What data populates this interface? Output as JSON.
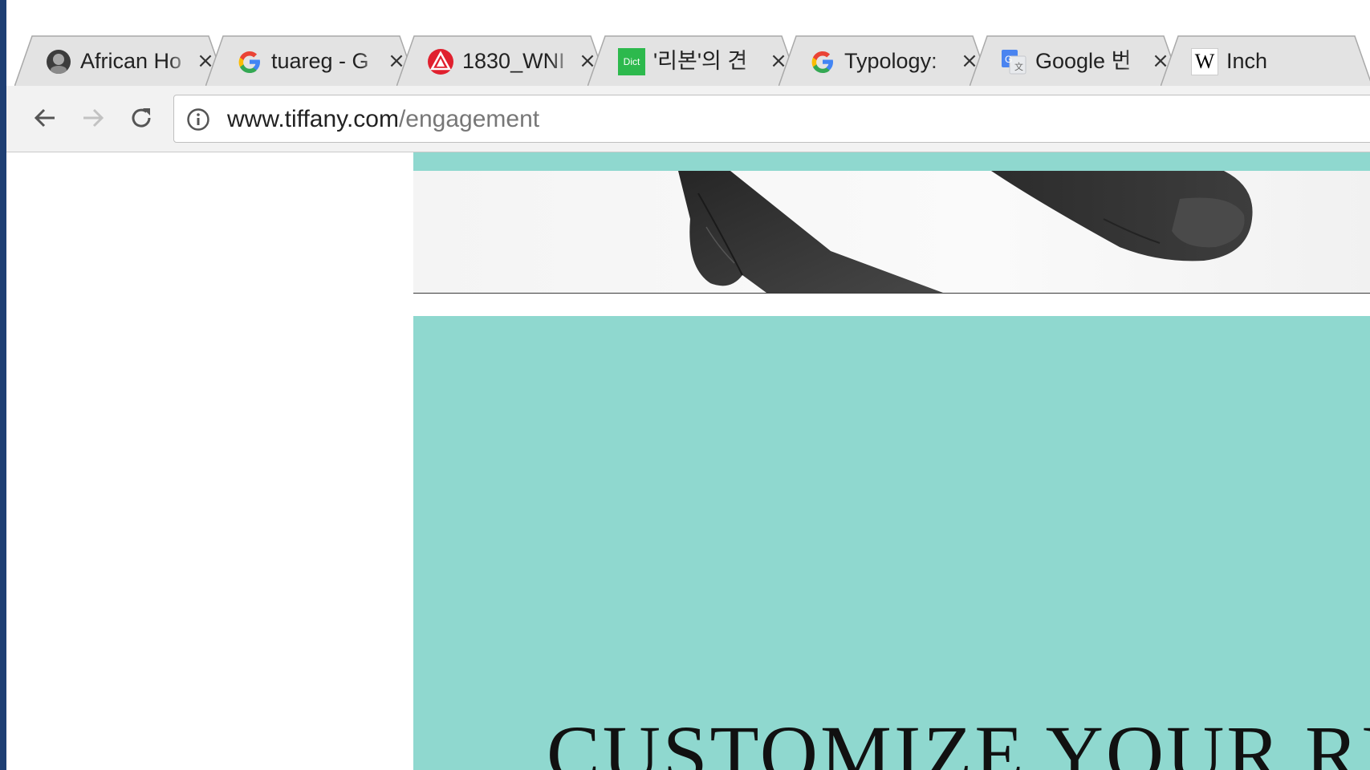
{
  "browser": {
    "tabs": [
      {
        "title": "African Ho",
        "favicon": "globe-face-icon"
      },
      {
        "title": "tuareg - G",
        "favicon": "google-icon"
      },
      {
        "title": "1830_WNI",
        "favicon": "red-triangle-icon"
      },
      {
        "title": "'리본'의 견",
        "favicon": "dict-icon",
        "favicon_text": "Dict"
      },
      {
        "title": "Typology:",
        "favicon": "google-icon"
      },
      {
        "title": "Google 번",
        "favicon": "google-translate-icon"
      },
      {
        "title": "Inch",
        "favicon": "wikipedia-icon",
        "favicon_text": "W"
      }
    ],
    "close_glyph": "×",
    "address": {
      "host": "www.tiffany.com",
      "path": "/engagement"
    }
  },
  "page": {
    "headline": "CUSTOMIZE YOUR RING"
  },
  "colors": {
    "tiffany_blue": "#8fd8cf",
    "tab_fill": "#e3e3e3",
    "toolbar": "#f2f2f2"
  }
}
